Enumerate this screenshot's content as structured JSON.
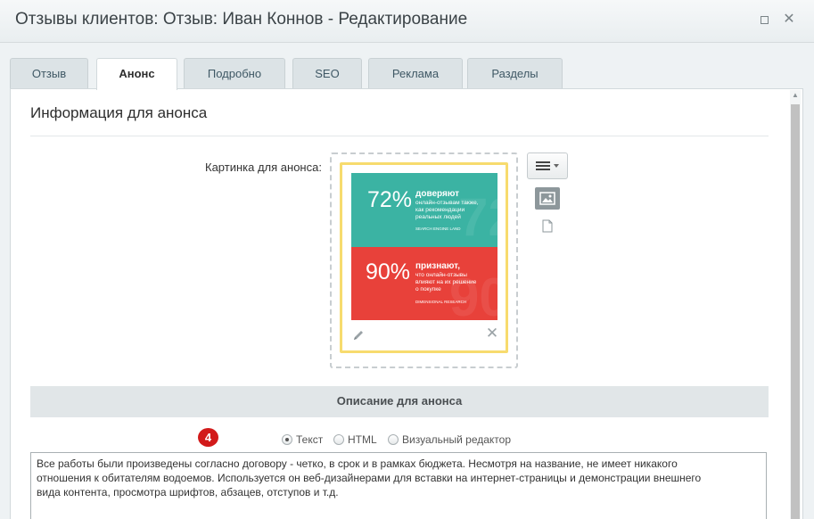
{
  "window": {
    "title": "Отзывы клиентов: Отзыв: Иван Коннов - Редактирование",
    "maximize_icon": "maximize-icon",
    "close_icon": "close-icon"
  },
  "tabs": [
    {
      "label": "Отзыв",
      "active": false
    },
    {
      "label": "Анонс",
      "active": true
    },
    {
      "label": "Подробно",
      "active": false
    },
    {
      "label": "SEO",
      "active": false
    },
    {
      "label": "Реклама",
      "active": false
    },
    {
      "label": "Разделы",
      "active": false
    }
  ],
  "section": {
    "title": "Информация для анонса"
  },
  "picture": {
    "label": "Картинка для анонса:",
    "image": {
      "stat1": {
        "percent": "72%",
        "headline": "доверяют",
        "text": [
          "онлайн-отзывам также,",
          "как рекомендации",
          "реальных людей"
        ],
        "source": "SEARCH ENGINE LAND",
        "color": "#3bb3a3"
      },
      "stat2": {
        "percent": "90%",
        "headline": "признают,",
        "text": [
          "что онлайн-отзывы",
          "влияют на их решение",
          "о покупке"
        ],
        "source": "DIMENSIONAL RESEARCH",
        "color": "#e8413a"
      }
    },
    "edit_icon": "pencil-icon",
    "remove_icon": "close-icon",
    "menu_icon": "hamburger-menu-icon",
    "image_icon": "image-icon",
    "file_icon": "file-icon",
    "frame_color": "#f7db6e"
  },
  "description": {
    "header": "Описание для анонса",
    "badge": "4",
    "badge_color": "#d21a1a",
    "modes": [
      {
        "label": "Текст",
        "checked": true
      },
      {
        "label": "HTML",
        "checked": false
      },
      {
        "label": "Визуальный редактор",
        "checked": false
      }
    ],
    "text_lines": [
      "Все работы были произведены согласно договору - четко, в срок и в рамках бюджета. Несмотря на название, не имеет никакого",
      "отношения к обитателям водоемов. Используется он веб-дизайнерами для вставки на интернет-страницы и демонстрации внешнего",
      "вида контента, просмотра шрифтов, абзацев, отступов и т.д."
    ]
  }
}
